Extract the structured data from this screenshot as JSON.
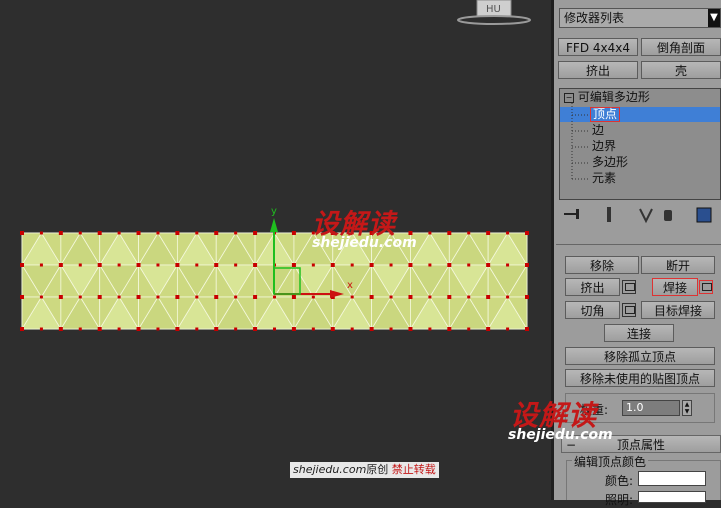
{
  "viewport": {
    "axis_y": "y",
    "axis_x": "x",
    "nav_cube_label": "HU"
  },
  "panel": {
    "modifier_list": "修改器列表",
    "buttons_row1": [
      "FFD 4x4x4",
      "倒角剖面"
    ],
    "buttons_row2": [
      "挤出",
      "壳"
    ],
    "stack": {
      "root": "可编辑多边形",
      "items": [
        "顶点",
        "边",
        "边界",
        "多边形",
        "元素"
      ]
    },
    "edit_vertices": {
      "remove": "移除",
      "break": "断开",
      "extrude": "挤出",
      "weld": "焊接",
      "chamfer": "切角",
      "target_weld": "目标焊接",
      "connect": "连接",
      "remove_isolated": "移除孤立顶点",
      "remove_unused_map": "移除未使用的贴图顶点",
      "weight_label": "权重:",
      "weight_value": "1.0"
    },
    "vertex_props": {
      "title": "顶点属性",
      "group": "编辑顶点颜色",
      "color_label": "颜色:",
      "illum_label": "照明:"
    }
  },
  "watermarks": {
    "logo1": "设解读",
    "url1": "shejiedu.com",
    "logo2": "设解读",
    "url2": "shejiedu.com",
    "footer_site": "shejiedu.com",
    "footer_orig": "原创",
    "footer_notice": "禁止转载"
  },
  "colors": {
    "mesh_fill": "#d4e28a",
    "vertex": "#c80000",
    "selection": "#3f7fd6",
    "highlight_border": "#dd3333"
  }
}
